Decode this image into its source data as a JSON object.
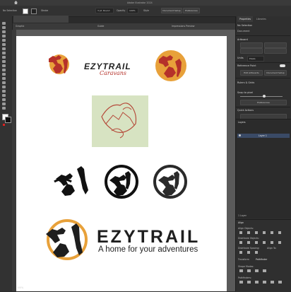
{
  "app": {
    "title": "Adobe Illustrator 2024"
  },
  "control_bar": {
    "selection_label": "No Selection",
    "stroke_label": "Stroke",
    "brush_label": "3 pt. Round",
    "opacity_label": "Opacity",
    "opacity_value": "100%",
    "style_label": "Style",
    "doc_setup_label": "Document Setup",
    "preferences_label": "Preferences"
  },
  "document_tab": {
    "label": "EzytrailRough1.ai* @ 100% (CMYK/Preview)"
  },
  "ruler_tabs": {
    "graphic": "Graphic",
    "guides": "Guide",
    "preview": "Impressions Preview"
  },
  "properties_panel": {
    "tabs": [
      "Properties",
      "Libraries"
    ],
    "no_selection": "No Selection",
    "document_label": "Document",
    "artboard_label": "Artboard",
    "units_label": "Units",
    "units_value": "Pixels",
    "grid_label": "Rulers & Grids",
    "ref_label": "Reference Point",
    "edit_artboards": "Edit Artboards",
    "doc_setup": "Document Setup",
    "preferences": "Preferences",
    "snap_label": "Snap to pixel",
    "quick_actions": "Quick Actions"
  },
  "layers_panel": {
    "title": "Layers",
    "layer_name": "Layer 1",
    "footer": "1 Layer"
  },
  "align_panel": {
    "title": "Align",
    "align_objects": "Align Objects:",
    "distribute_objects": "Distribute Objects:",
    "distribute_spacing": "Distribute Spacing:",
    "align_to": "Align To:",
    "tabs": [
      "Transform",
      "Pathfinder"
    ],
    "shape_modes": "Shape Modes:",
    "pathfinders": "Pathfinders:"
  },
  "artwork": {
    "logo1_brand": "EZYTRAIL",
    "logo1_script": "Caravans",
    "logo_main_brand": "EZYTRAIL",
    "logo_main_tagline": "A home for your adventures"
  },
  "status_bar": {
    "zoom": "100%"
  },
  "colors": {
    "accent_orange": "#E8A13A",
    "brand_red": "#B5312A",
    "sketch_bg": "#D7E3C2",
    "sketch_line": "#B54A3A"
  }
}
